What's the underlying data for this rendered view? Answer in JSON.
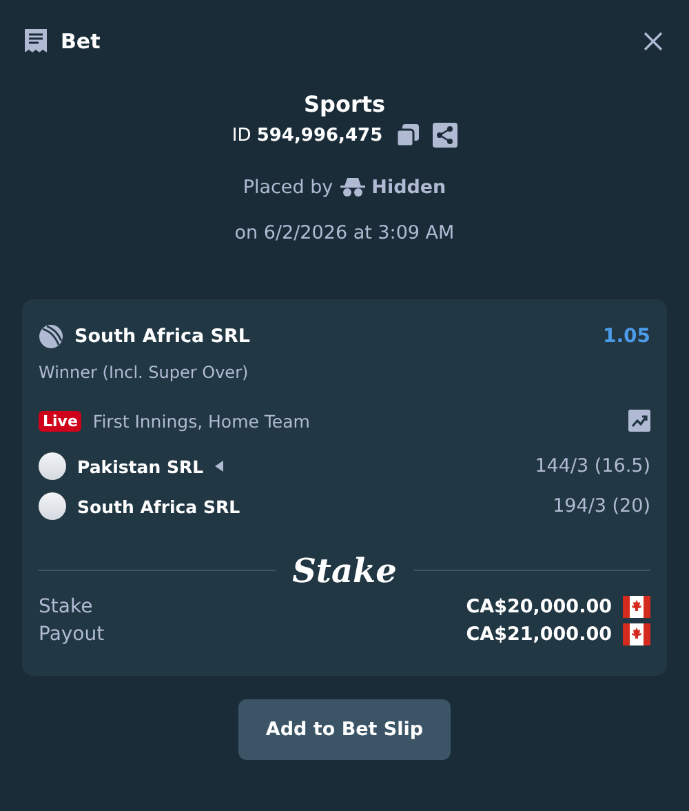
{
  "header": {
    "title": "Bet"
  },
  "summary": {
    "category": "Sports",
    "id_text": "ID **594,996,475**",
    "placed_by_label": "Placed by",
    "placed_by_user": "Hidden",
    "date": "on 6/2/2026 at 3:09 AM"
  },
  "selection": {
    "team": "South Africa SRL",
    "odds": "1.05",
    "market": "Winner (Incl. Super Over)",
    "live_badge": "Live",
    "status": "First Innings, Home Team",
    "teams": [
      {
        "name": "Pakistan SRL",
        "batting": true,
        "score": "144/3 (16.5)"
      },
      {
        "name": "South Africa SRL",
        "batting": false,
        "score": "194/3 (20)"
      }
    ]
  },
  "brand": "Stake",
  "totals": [
    {
      "label": "Stake",
      "amount": "CA$20,000.00"
    },
    {
      "label": "Payout",
      "amount": "CA$21,000.00"
    }
  ],
  "action_button": "Add to Bet Slip"
}
